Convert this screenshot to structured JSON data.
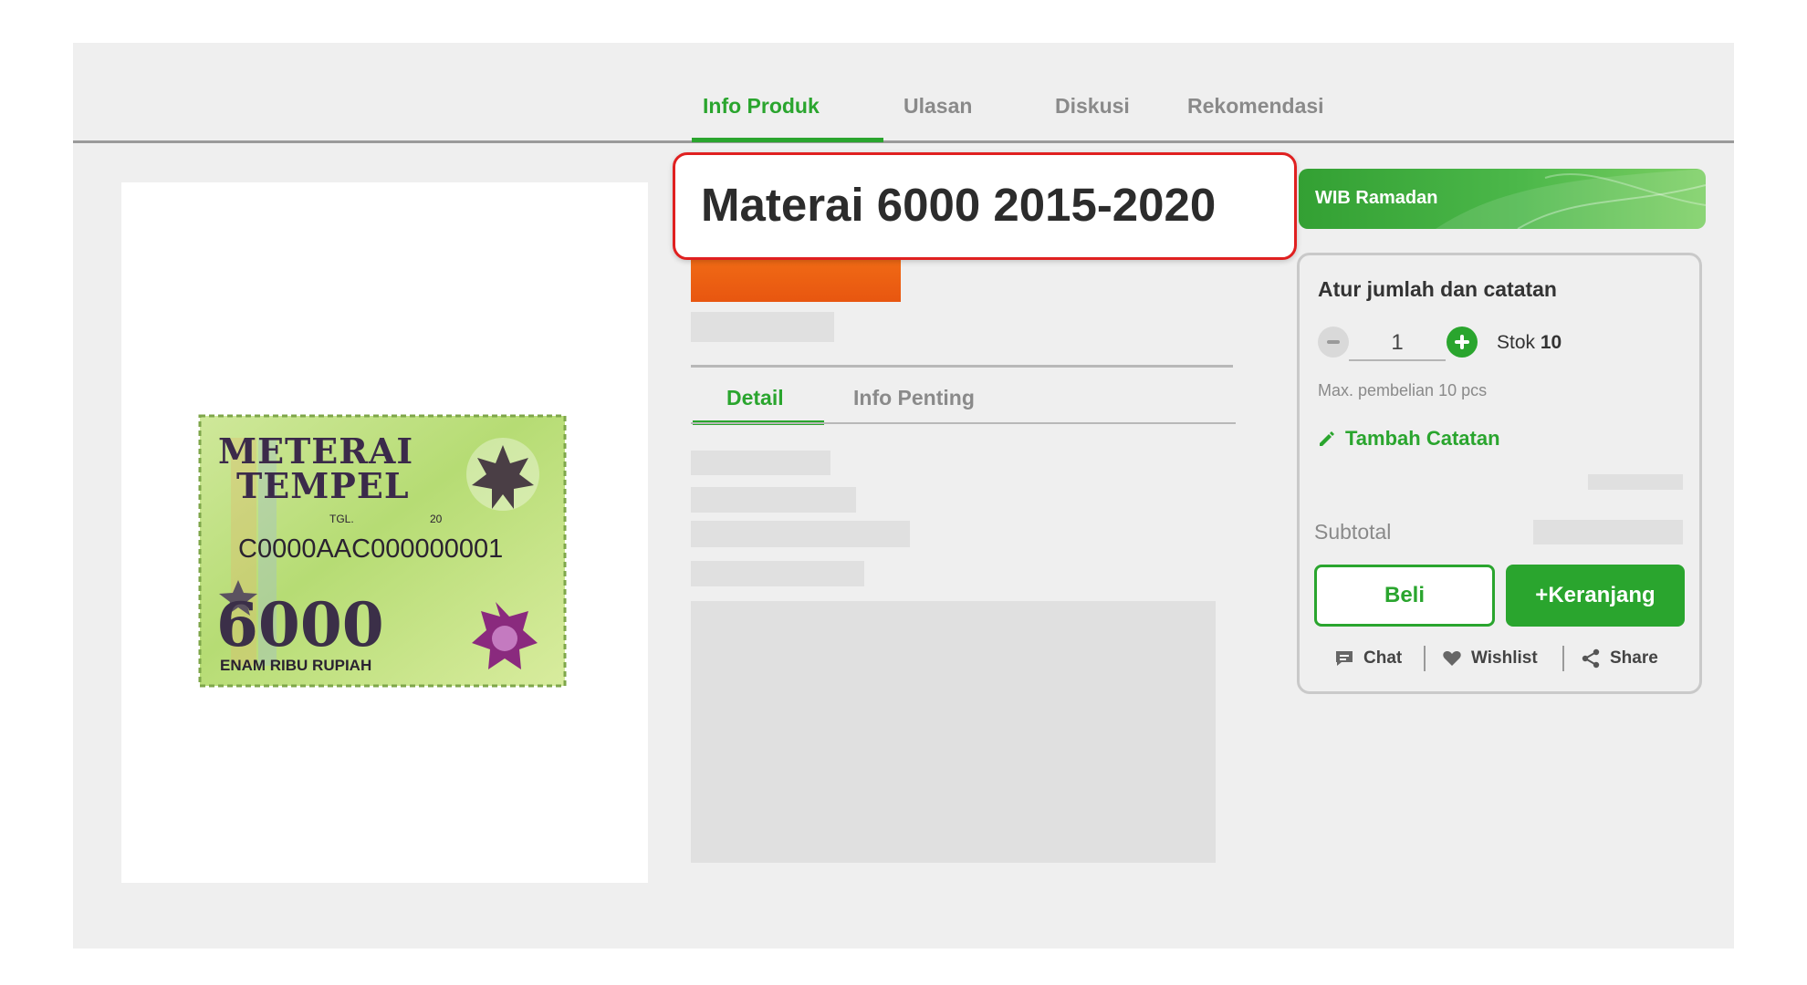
{
  "tabs": {
    "info_produk": "Info Produk",
    "ulasan": "Ulasan",
    "diskusi": "Diskusi",
    "rekomendasi": "Rekomendasi"
  },
  "product": {
    "title": "Materai 6000 2015-2020"
  },
  "stamp": {
    "line1": "METERAI",
    "line2": "TEMPEL",
    "tgl": "TGL.",
    "year": "20",
    "serial": "C0000AAC000000001",
    "value": "6000",
    "value_words": "ENAM RIBU RUPIAH"
  },
  "detail_tabs": {
    "detail": "Detail",
    "info_penting": "Info Penting"
  },
  "promo": {
    "label": "WIB Ramadan"
  },
  "purchase": {
    "title": "Atur jumlah dan catatan",
    "quantity": "1",
    "stock_label": "Stok",
    "stock_value": "10",
    "max_note": "Max. pembelian 10 pcs",
    "add_note": "Tambah Catatan",
    "subtotal_label": "Subtotal",
    "buy": "Beli",
    "add_to_cart": "+Keranjang"
  },
  "actions": {
    "chat": "Chat",
    "wishlist": "Wishlist",
    "share": "Share"
  },
  "colors": {
    "accent": "#2aa52e",
    "price_bar": "#f06a15",
    "highlight_border": "#e02020"
  }
}
